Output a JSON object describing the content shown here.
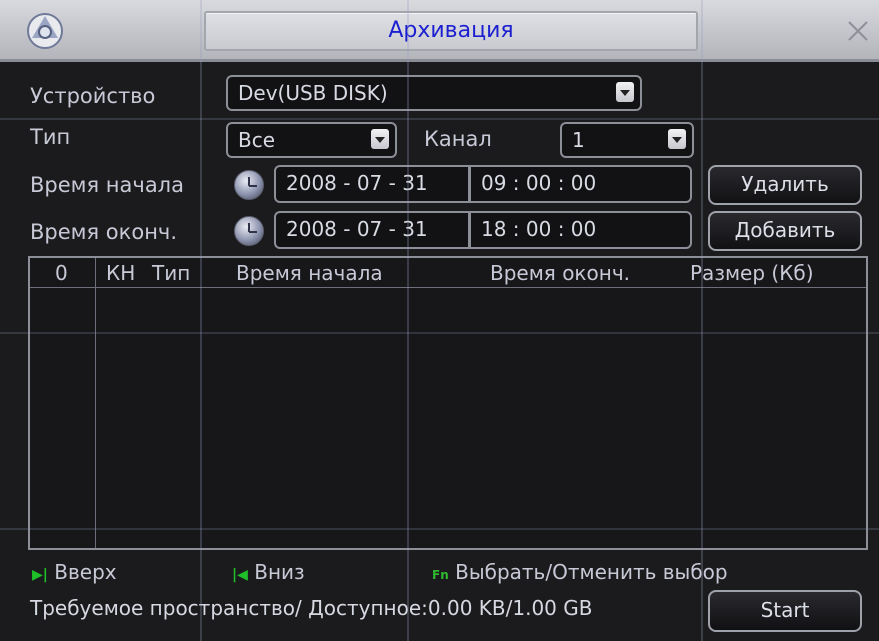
{
  "window": {
    "title": "Архивация"
  },
  "form": {
    "device_label": "Устройство",
    "device_value": "Dev(USB DISK)",
    "type_label": "Тип",
    "type_value": "Все",
    "channel_label": "Канал",
    "channel_value": "1",
    "start_label": "Время начала",
    "start_date": "2008  - 07 - 31",
    "start_time": "09 : 00 : 00",
    "end_label": "Время оконч.",
    "end_date": "2008  - 07 - 31",
    "end_time": "18 : 00 : 00"
  },
  "buttons": {
    "delete": "Удалить",
    "add": "Добавить",
    "start": "Start"
  },
  "table": {
    "columns": [
      "0",
      "КН",
      "Тип",
      "Время начала",
      "Время оконч.",
      "Размер (Кб)"
    ],
    "rows": []
  },
  "footer": {
    "up_label": "Вверх",
    "down_label": "Вниз",
    "fn_icon": "Fn",
    "select_label": "Выбрать/Отменить выбор",
    "space_text": "Требуемое пространство/ Доступное:0.00 KB/1.00 GB"
  },
  "colors": {
    "title_text": "#1b1fd0",
    "background": "#1b1b1d",
    "hint_icon": "#1fbf2a"
  }
}
